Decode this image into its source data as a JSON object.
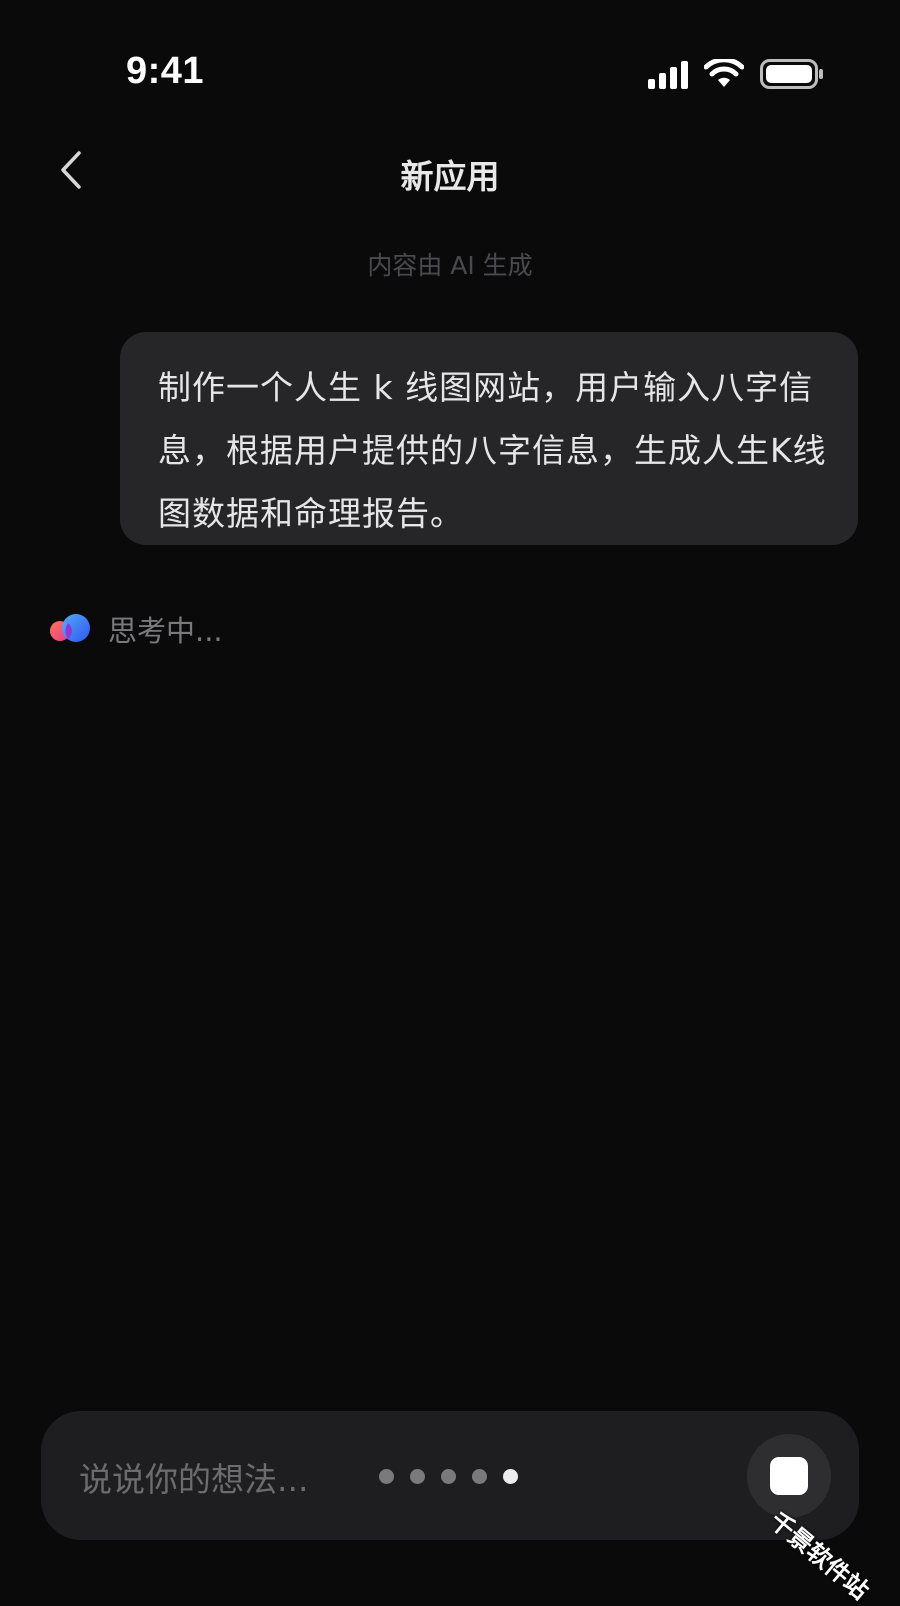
{
  "status_bar": {
    "time": "9:41",
    "icons": [
      "cellular-signal-icon",
      "wifi-icon",
      "battery-icon"
    ]
  },
  "header": {
    "title": "新应用",
    "back_icon": "chevron-left-icon"
  },
  "notice": "内容由 AI 生成",
  "messages": [
    {
      "role": "user",
      "text": "制作一个人生 k 线图网站，用户输入八字信息，根据用户提供的八字信息，生成人生K线图数据和命理报告。"
    }
  ],
  "assistant_status": {
    "icon": "ai-logo-icon",
    "label": "思考中..."
  },
  "input_bar": {
    "placeholder": "说说你的想法...",
    "loading_dots": 5,
    "active_dot": 5,
    "stop_icon": "stop-icon"
  },
  "watermark": "千景软件站",
  "colors": {
    "background": "#0a0a0b",
    "bubble": "#262628",
    "input_bar": "#1e1e20",
    "logo_pink": "#ff4f8a",
    "logo_blue": "#3d6cff"
  }
}
